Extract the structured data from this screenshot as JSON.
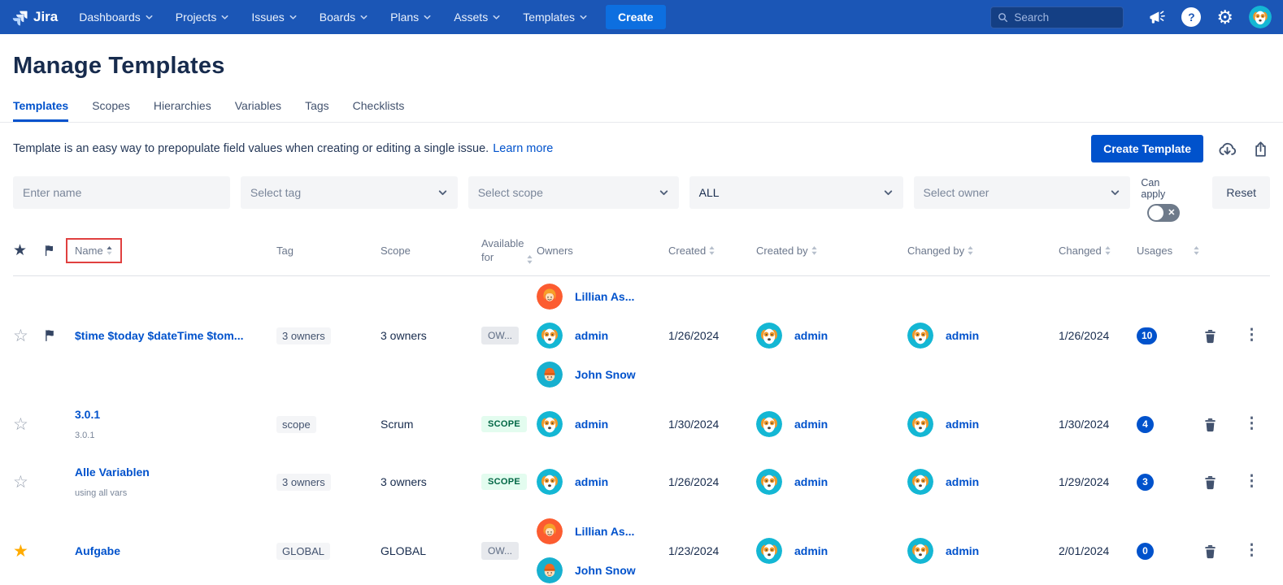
{
  "nav": {
    "brand": "Jira",
    "items": [
      "Dashboards",
      "Projects",
      "Issues",
      "Boards",
      "Plans",
      "Assets",
      "Templates"
    ],
    "create_label": "Create",
    "search_placeholder": "Search"
  },
  "page": {
    "title": "Manage Templates",
    "tabs": [
      "Templates",
      "Scopes",
      "Hierarchies",
      "Variables",
      "Tags",
      "Checklists"
    ],
    "description": "Template is an easy way to prepopulate field values when creating or editing a single issue.",
    "learn_more_label": "Learn more",
    "create_template_label": "Create Template"
  },
  "filters": {
    "name_placeholder": "Enter name",
    "tag_placeholder": "Select tag",
    "scope_placeholder": "Select scope",
    "availability_value": "ALL",
    "owner_placeholder": "Select owner",
    "can_apply_label": "Can apply",
    "reset_label": "Reset"
  },
  "table": {
    "headers": {
      "name": "Name",
      "tag": "Tag",
      "scope": "Scope",
      "available_for": "Available for",
      "owners": "Owners",
      "created": "Created",
      "created_by": "Created by",
      "changed_by": "Changed by",
      "changed": "Changed",
      "usages": "Usages"
    },
    "rows": [
      {
        "starred": false,
        "flagged": true,
        "name": "$time $today $dateTime $tom...",
        "subtitle": "",
        "tag": "3 owners",
        "scope": "3 owners",
        "available_for": {
          "label": "OW...",
          "type": "gray"
        },
        "owners": [
          {
            "name": "Lillian As...",
            "avatar": "lillian"
          },
          {
            "name": "admin",
            "avatar": "dog"
          },
          {
            "name": "John Snow",
            "avatar": "john"
          }
        ],
        "created": "1/26/2024",
        "created_by": {
          "name": "admin",
          "avatar": "dog"
        },
        "changed_by": {
          "name": "admin",
          "avatar": "dog"
        },
        "changed": "1/26/2024",
        "usages": "10"
      },
      {
        "starred": false,
        "flagged": false,
        "name": "3.0.1",
        "subtitle": "3.0.1",
        "tag": "scope",
        "scope": "Scrum",
        "available_for": {
          "label": "SCOPE",
          "type": "green"
        },
        "owners": [
          {
            "name": "admin",
            "avatar": "dog"
          }
        ],
        "created": "1/30/2024",
        "created_by": {
          "name": "admin",
          "avatar": "dog"
        },
        "changed_by": {
          "name": "admin",
          "avatar": "dog"
        },
        "changed": "1/30/2024",
        "usages": "4"
      },
      {
        "starred": false,
        "flagged": false,
        "name": "Alle Variablen",
        "subtitle": "using all vars",
        "tag": "3 owners",
        "scope": "3 owners",
        "available_for": {
          "label": "SCOPE",
          "type": "green"
        },
        "owners": [
          {
            "name": "admin",
            "avatar": "dog"
          }
        ],
        "created": "1/26/2024",
        "created_by": {
          "name": "admin",
          "avatar": "dog"
        },
        "changed_by": {
          "name": "admin",
          "avatar": "dog"
        },
        "changed": "1/29/2024",
        "usages": "3"
      },
      {
        "starred": true,
        "flagged": false,
        "name": "Aufgabe",
        "subtitle": "",
        "tag": "GLOBAL",
        "scope": "GLOBAL",
        "available_for": {
          "label": "OW...",
          "type": "gray"
        },
        "owners": [
          {
            "name": "Lillian As...",
            "avatar": "lillian"
          },
          {
            "name": "John Snow",
            "avatar": "john"
          }
        ],
        "created": "1/23/2024",
        "created_by": {
          "name": "admin",
          "avatar": "dog"
        },
        "changed_by": {
          "name": "admin",
          "avatar": "dog"
        },
        "changed": "2/01/2024",
        "usages": "0"
      }
    ]
  },
  "colors": {
    "nav_background": "#1B56B6",
    "accent_blue": "#0052CC",
    "badge_blue": "#0052CC",
    "scope_chip_bg": "#E3FCEF",
    "scope_chip_text": "#006644",
    "star_active": "#FFAB00",
    "highlight_red": "#E0403F"
  },
  "icons": {
    "nav": [
      "search-icon",
      "megaphone-icon",
      "help-icon",
      "gear-icon",
      "user-avatar"
    ],
    "toolbar": [
      "cloud-download-icon",
      "export-icon"
    ],
    "rows": [
      "star-icon",
      "flag-icon",
      "trash-icon",
      "kebab-menu-icon"
    ]
  }
}
